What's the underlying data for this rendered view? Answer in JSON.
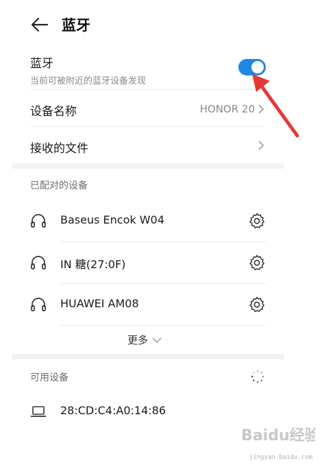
{
  "header": {
    "title": "蓝牙"
  },
  "bluetooth": {
    "label": "蓝牙",
    "subtitle": "当前可被附近的蓝牙设备发现",
    "enabled": true
  },
  "device_name": {
    "label": "设备名称",
    "value": "HONOR 20"
  },
  "received_files": {
    "label": "接收的文件"
  },
  "paired": {
    "title": "已配对的设备",
    "devices": [
      {
        "name": "Baseus Encok W04",
        "icon": "headphones-icon"
      },
      {
        "name": "IN 糖(27:0F)",
        "icon": "headphones-icon"
      },
      {
        "name": "HUAWEI AM08",
        "icon": "headphones-icon"
      }
    ],
    "more_label": "更多"
  },
  "available": {
    "title": "可用设备",
    "devices": [
      {
        "name": "28:CD:C4:A0:14:86",
        "icon": "laptop-icon"
      }
    ]
  },
  "watermark": {
    "text": "Baidu经验",
    "url": "jingyan.baidu.com"
  },
  "colors": {
    "accent": "#1e88e5",
    "annotation": "#e53935"
  }
}
